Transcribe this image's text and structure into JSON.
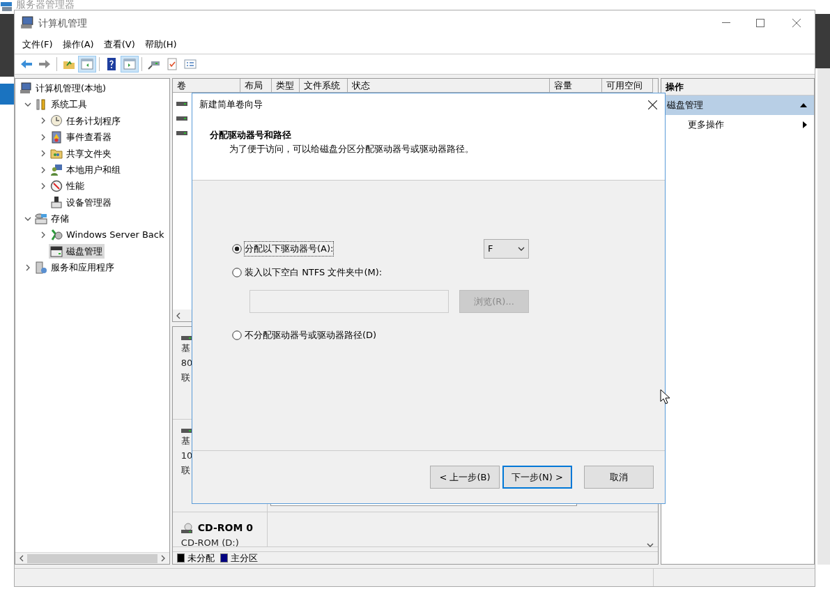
{
  "background_window": {
    "title": "服务器管理器"
  },
  "window": {
    "title": "计算机管理"
  },
  "menu": [
    "文件(F)",
    "操作(A)",
    "查看(V)",
    "帮助(H)"
  ],
  "toolbar": [
    [
      {
        "kind": "back",
        "pressed": false
      },
      {
        "kind": "forward",
        "pressed": false
      }
    ],
    [
      {
        "kind": "up",
        "pressed": false
      },
      {
        "kind": "tree",
        "pressed": true
      }
    ],
    [
      {
        "kind": "help",
        "pressed": false
      },
      {
        "kind": "pane",
        "pressed": true
      }
    ],
    [
      {
        "kind": "connect",
        "pressed": false
      },
      {
        "kind": "check",
        "pressed": false
      },
      {
        "kind": "list",
        "pressed": false
      }
    ]
  ],
  "tree": {
    "label": "计算机管理(本地)",
    "selected": false,
    "children": [
      {
        "label": "系统工具",
        "expanded": true,
        "selected": false,
        "children": [
          {
            "label": "任务计划程序",
            "expanded": false,
            "selected": false
          },
          {
            "label": "事件查看器",
            "expanded": false,
            "selected": false
          },
          {
            "label": "共享文件夹",
            "expanded": false,
            "selected": false
          },
          {
            "label": "本地用户和组",
            "expanded": false,
            "selected": false
          },
          {
            "label": "性能",
            "expanded": false,
            "selected": false
          },
          {
            "label": "设备管理器",
            "selected": false
          }
        ]
      },
      {
        "label": "存储",
        "expanded": true,
        "selected": false,
        "children": [
          {
            "label": "Windows Server Back",
            "expanded": false,
            "selected": false
          },
          {
            "label": "磁盘管理",
            "selected": true
          }
        ]
      },
      {
        "label": "服务和应用程序",
        "expanded": false,
        "selected": false
      }
    ]
  },
  "volume_list": {
    "columns": [
      "卷",
      "布局",
      "类型",
      "文件系统",
      "状态",
      "容量",
      "可用空间"
    ],
    "rows": [
      {
        "kind": "disk"
      },
      {
        "kind": "disk"
      },
      {
        "kind": "disk"
      }
    ]
  },
  "disks": [
    {
      "kind": "disk",
      "lines": [
        "基",
        "80",
        "联"
      ]
    },
    {
      "kind": "disk",
      "lines": [
        "基",
        "10",
        "联"
      ]
    },
    {
      "kind": "cdrom",
      "name": "CD-ROM 0",
      "lines": [
        "CD-ROM (D:)"
      ]
    }
  ],
  "legend": [
    {
      "label": "未分配",
      "color": "#000000"
    },
    {
      "label": "主分区",
      "color": "#000080"
    }
  ],
  "actions": {
    "title": "操作",
    "items": [
      {
        "label": "磁盘管理",
        "kind": "section",
        "expanded": true
      },
      {
        "label": "更多操作",
        "kind": "submenu"
      }
    ]
  },
  "dialog": {
    "title": "新建简单卷向导",
    "heading": "分配驱动器号和路径",
    "subtitle": "为了便于访问，可以给磁盘分区分配驱动器号或驱动器路径。",
    "options": [
      {
        "label": "分配以下驱动器号(A):",
        "selected": true
      },
      {
        "label": "装入以下空白 NTFS 文件夹中(M):",
        "selected": false
      },
      {
        "label": "不分配驱动器号或驱动器路径(D)",
        "selected": false
      }
    ],
    "drive_letter": {
      "value": "F"
    },
    "folder_path": {
      "disabled": true
    },
    "browse_button": {
      "label": "浏览(R)...",
      "disabled": true
    },
    "buttons": [
      {
        "label": "< 上一步(B)",
        "focused": false
      },
      {
        "label": "下一步(N) >",
        "focused": true
      },
      {
        "label": "取消",
        "focused": false
      }
    ]
  }
}
